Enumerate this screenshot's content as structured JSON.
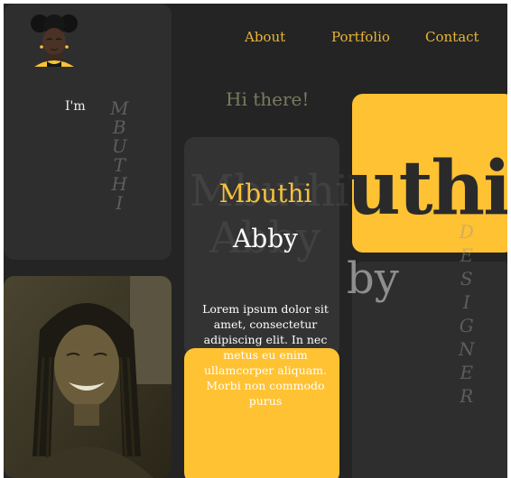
{
  "nav": {
    "about": "About",
    "portfolio": "Portfolio",
    "contact": "Contact"
  },
  "hero": {
    "intro": "I'm",
    "vertical_name": [
      "M",
      "B",
      "U",
      "T",
      "H",
      "I"
    ],
    "vertical_role": [
      "D",
      "E",
      "S",
      "I",
      "G",
      "N",
      "E",
      "R"
    ],
    "greeting": "Hi there!",
    "first_name": "Mbuthi",
    "last_name": "Abby",
    "ghost_first": "Mbuthi",
    "ghost_last": "Abby",
    "big_first_fragment": "uthi",
    "big_last_fragment": "by",
    "bio": "Lorem ipsum dolor sit amet, consectetur adipiscing elit. In nec metus eu enim ullamcorper aliquam. Morbi non commodo purus"
  },
  "colors": {
    "background": "#242424",
    "accent": "#ffc233",
    "nav_text": "#e8b53a",
    "card": "#2e2e2e"
  },
  "icons": {
    "avatar": "cartoon-avatar-icon",
    "photo": "profile-photo"
  }
}
